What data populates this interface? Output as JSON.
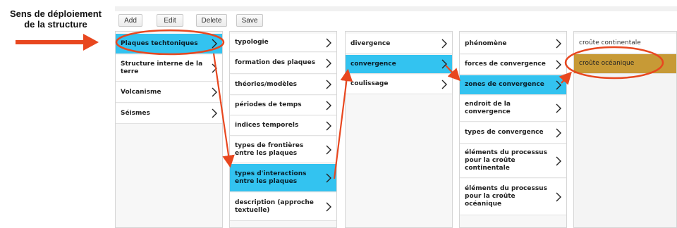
{
  "caption": {
    "line1": "Sens de déploiement",
    "line2": "de la structure"
  },
  "toolbar": {
    "add_label": "Add",
    "edit_label": "Edit",
    "delete_label": "Delete",
    "save_label": "Save"
  },
  "colors": {
    "selected": "#33c3f0",
    "highlight": "#c79a36",
    "annotation": "#e8471f"
  },
  "columns": [
    {
      "items": [
        {
          "label": "Plaques techtoniques",
          "selected": true,
          "chevron": true
        },
        {
          "label": "Structure interne de la terre",
          "chevron": true
        },
        {
          "label": "Volcanisme",
          "chevron": true
        },
        {
          "label": "Séismes",
          "chevron": true
        }
      ]
    },
    {
      "items": [
        {
          "label": "typologie",
          "chevron": true
        },
        {
          "label": "formation des plaques",
          "chevron": true
        },
        {
          "label": "théories/modèles",
          "chevron": true
        },
        {
          "label": "périodes de temps",
          "chevron": true
        },
        {
          "label": "indices temporels",
          "chevron": true
        },
        {
          "label": "types de frontières entre les plaques",
          "chevron": true
        },
        {
          "label": "types d'interactions entre les plaques",
          "selected": true,
          "chevron": true
        },
        {
          "label": "description (approche textuelle)",
          "chevron": true
        }
      ]
    },
    {
      "items": [
        {
          "label": "divergence",
          "chevron": true
        },
        {
          "label": "convergence",
          "selected": true,
          "chevron": true
        },
        {
          "label": "coulissage",
          "chevron": true
        }
      ]
    },
    {
      "items": [
        {
          "label": "phénomène",
          "chevron": true
        },
        {
          "label": "forces de convergence",
          "chevron": true
        },
        {
          "label": "zones de convergence",
          "selected": true,
          "chevron": true
        },
        {
          "label": "endroit de la convergence",
          "chevron": true
        },
        {
          "label": "types de convergence",
          "chevron": true
        },
        {
          "label": "éléments du processus pour la croûte continentale",
          "chevron": true
        },
        {
          "label": "éléments du processus pour la croûte océanique",
          "chevron": true
        }
      ]
    },
    {
      "items": [
        {
          "label": "croûte continentale"
        },
        {
          "label": "croûte océanique",
          "highlighted": true
        }
      ]
    }
  ]
}
